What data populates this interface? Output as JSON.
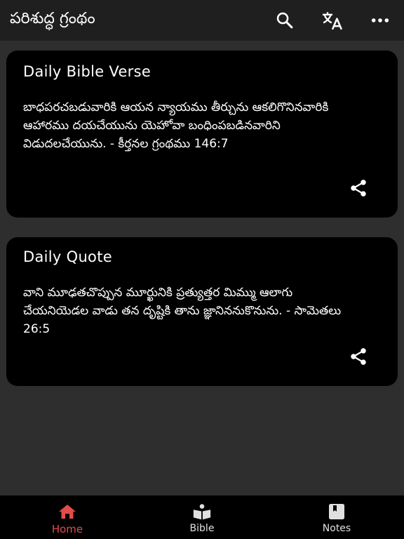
{
  "app_bar": {
    "title": "పరిశుద్ధ గ్రంథం",
    "actions": [
      {
        "icon": "search-icon"
      },
      {
        "icon": "translate-icon"
      },
      {
        "icon": "more-vert-icon"
      }
    ]
  },
  "cards": {
    "verse": {
      "title": "Daily Bible Verse",
      "body": "బాధపరచబడువారికి ఆయన న్యాయము తీర్చును ఆకలిగొనినవారికి ఆహారము దయచేయును యెహోవా బంధింపబడినవారిని విడుదలచేయును. - కీర్తనల గ్రంథము 146:7",
      "share_icon": "share-icon"
    },
    "quote": {
      "title": "Daily Quote",
      "body": "వాని మూఢతచొప్పున మూర్ఖునికి ప్రత్యుత్తర మిమ్ము ఆలాగు చేయనియెడల వాడు తన దృష్టికి తాను జ్ఞానిననుకొనును. - సామెతలు 26:5",
      "share_icon": "share-icon"
    }
  },
  "bottom_nav": {
    "items": [
      {
        "label": "Home",
        "icon": "home-icon",
        "active": true
      },
      {
        "label": "Bible",
        "icon": "bible-book-icon",
        "active": false
      },
      {
        "label": "Notes",
        "icon": "notes-icon",
        "active": false
      }
    ]
  },
  "colors": {
    "background": "#2e2e2e",
    "app_bar": "#1f1f1f",
    "card": "#000000",
    "accent_active": "#e34b4b",
    "icon": "#ffffff"
  }
}
